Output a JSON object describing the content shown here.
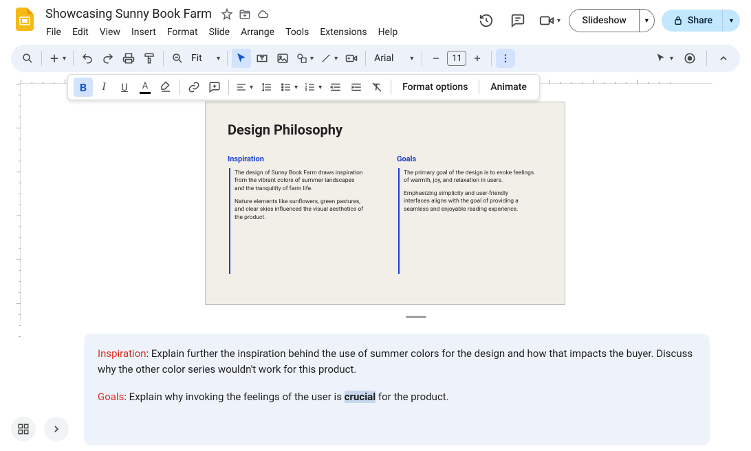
{
  "doc": {
    "title": "Showcasing Sunny Book Farm"
  },
  "menus": [
    "File",
    "Edit",
    "View",
    "Insert",
    "Format",
    "Slide",
    "Arrange",
    "Tools",
    "Extensions",
    "Help"
  ],
  "header_buttons": {
    "slideshow": "Slideshow",
    "share": "Share"
  },
  "toolbar": {
    "zoom": "Fit",
    "font": "Arial",
    "size": "11"
  },
  "toolbar2": {
    "format_options": "Format options",
    "animate": "Animate"
  },
  "slide": {
    "title": "Design Philosophy",
    "col1": {
      "head": "Inspiration",
      "p1": "The design of Sunny Book Farm draws inspiration from the vibrant colors of summer landscapes and the tranquility of farm life.",
      "p2": "Nature elements like sunflowers, green pastures, and clear skies influenced the visual aesthetics of the product."
    },
    "col2": {
      "head": "Goals",
      "p1": "The primary goal of the design is to evoke feelings of warmth, joy, and relaxation in users.",
      "p2": "Emphasizing simplicity and user-friendly interfaces aligns with the goal of providing a seamless and enjoyable reading experience."
    }
  },
  "notes": {
    "n1_label": "Inspiration",
    "n1_rest": ": Explain further the inspiration behind the use of summer colors for the design and how that impacts the buyer. Discuss why the other color series wouldn't work for this product.",
    "n2_label": "Goals",
    "n2_a": ": Explain why invoking the feelings of the user is ",
    "n2_sel": "crucial",
    "n2_b": " for the product."
  }
}
